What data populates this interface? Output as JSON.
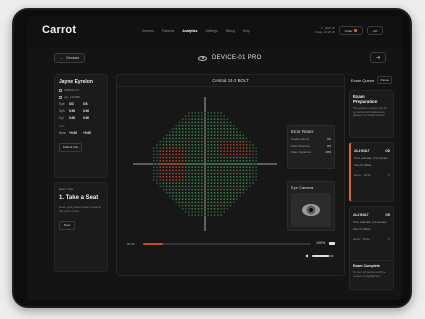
{
  "app": {
    "logo": "Carrot"
  },
  "nav": {
    "items": [
      "Devices",
      "Patients",
      "Analytics",
      "Settings",
      "Billing",
      "Help"
    ],
    "active_index": 2
  },
  "topbar": {
    "date": "Friday, 20:20:00",
    "date_line1": "4 · 2025 20",
    "pill_label": "Order",
    "right_button": "+ID"
  },
  "subbar": {
    "devices_button": "Devices",
    "device_title": "DEVICE-01 PRO",
    "exit_icon": "exit-icon"
  },
  "patient": {
    "name": "Jayne Eyrelon",
    "dob": "1990-01-27",
    "id": "ptn_123456",
    "rows": [
      {
        "k": "Eye",
        "a": "OD",
        "b": "OS"
      },
      {
        "k": "Sph",
        "a": "0.00",
        "b": "0.00"
      },
      {
        "k": "Cyl",
        "a": "0.00",
        "b": "0.00"
      }
    ],
    "section": "Axis",
    "row2": {
      "k": "Near",
      "a": "+0.00",
      "b": "+0.00"
    },
    "pill": "Patient Info"
  },
  "tips": {
    "label": "Exam Tips",
    "title": "1. Take a Seat",
    "body": "Have your patient take a seat in the exam room.",
    "button": "Next"
  },
  "main": {
    "header": "Central 24-2 BOLT",
    "time": "00:00",
    "progress_fraction": 0.12,
    "percent": "100%",
    "volume_fraction": 0.75
  },
  "metrics": {
    "title": "Error Rates",
    "rows": [
      {
        "k": "Fixation Errors",
        "v": "0/0"
      },
      {
        "k": "False Positives",
        "v": "0%"
      },
      {
        "k": "False Negatives",
        "v": "40%"
      }
    ]
  },
  "camera": {
    "title": "Eye Camera"
  },
  "queue": {
    "title": "Exam Queue",
    "pause": "Pause",
    "prep_title": "Exam Preparation",
    "prep_body": "The patient's vision may be corrected with trial lenses, glasses or contact lenses.",
    "exams": [
      {
        "name": "24-2 BOLT",
        "eye": "OD",
        "time": "Time estimate: 3:4 minutes",
        "size": "Size III, White",
        "foot": "Exam · White"
      },
      {
        "name": "24-2 BOLT",
        "eye": "OS",
        "time": "Time estimate: 3:4 minutes",
        "size": "Size III, White",
        "foot": "Exam · White"
      }
    ],
    "complete_title": "Exam Complete",
    "complete_body": "Do turn off device until the session is highlighted."
  },
  "colors": {
    "accent": "#d6653b",
    "background": "#141414"
  }
}
